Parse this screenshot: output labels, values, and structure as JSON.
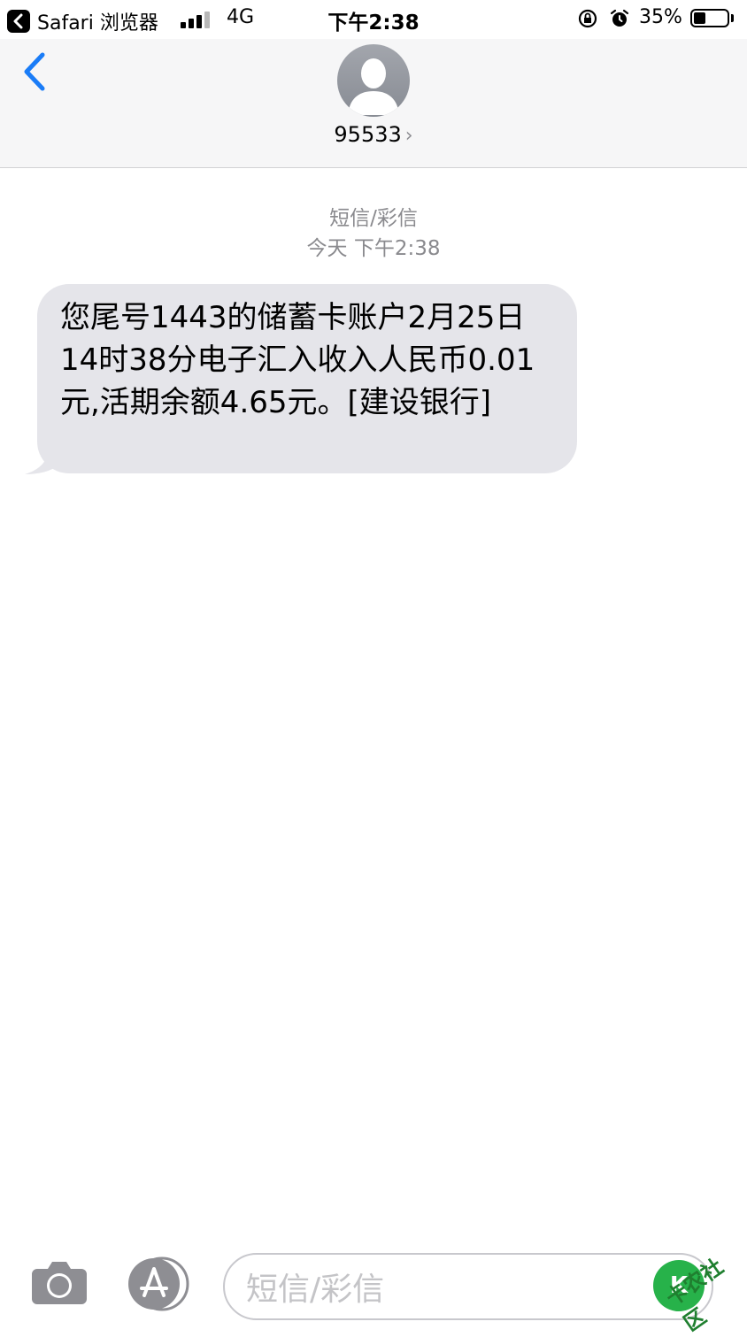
{
  "status_bar": {
    "back_app": "Safari 浏览器",
    "network": "4G",
    "time": "下午2:38",
    "battery": "35%",
    "battery_level": 0.35
  },
  "header": {
    "contact": "95533"
  },
  "conversation": {
    "type_label": "短信/彩信",
    "timestamp": "今天 下午2:38",
    "messages": [
      {
        "text": "您尾号1443的储蓄卡账户2月25日14时38分电子汇入收入人民币0.01元,活期余额4.65元。[建设银行]"
      }
    ]
  },
  "input_bar": {
    "placeholder": "短信/彩信"
  },
  "watermark": {
    "text": "卡农社区",
    "color": "#27b24a"
  },
  "colors": {
    "accent": "#1a7cf7",
    "bubble_gray": "#e5e5ea",
    "header_bg": "#f6f6f7"
  }
}
